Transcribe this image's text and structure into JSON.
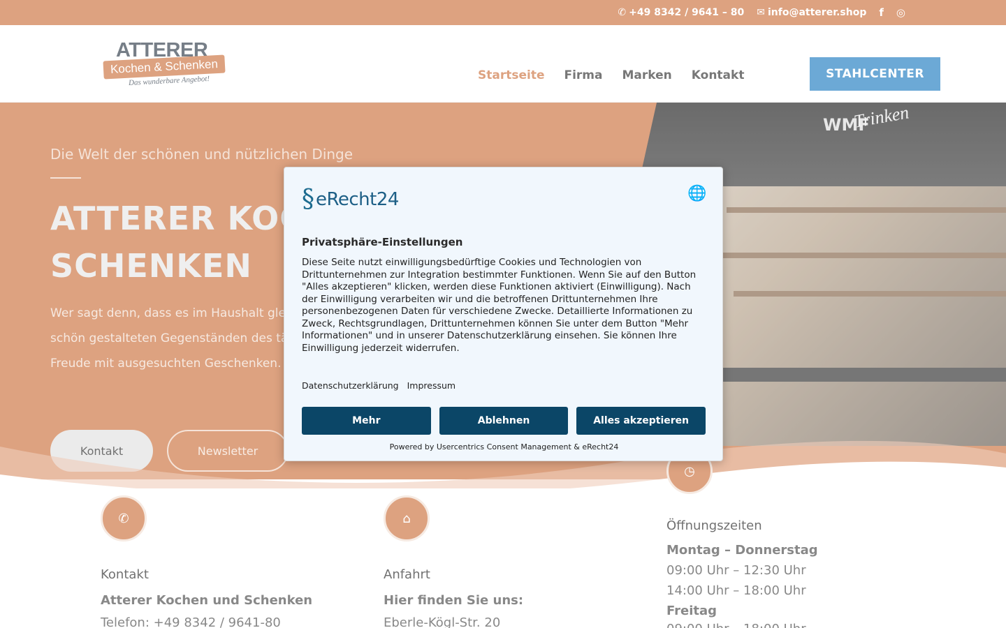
{
  "topbar": {
    "phone": "+49 8342 / 9641 – 80",
    "email": "info@atterer.shop",
    "social": [
      "facebook-icon",
      "instagram-icon"
    ]
  },
  "header": {
    "logo_line1": "ATTERER",
    "logo_line2": "Kochen & Schenken",
    "logo_line3": "Das wunderbare Angebot!",
    "nav": [
      "Startseite",
      "Firma",
      "Marken",
      "Kontakt"
    ],
    "cta": "STAHLCENTER"
  },
  "hero": {
    "tagline": "Die Welt der schönen und nützlichen Dinge",
    "title": "ATTERER KOCHEN UND SCHENKEN",
    "paragraph": "Wer sagt denn, dass es im Haushalt gleichgültig zugehen muss? Erfreuen Sie sich an schön gestalteten Gegenständen des täglichen Lebens und machen Sie anderen eine Freude mit ausgesuchten Geschenken.",
    "btn_kontakt": "Kontakt",
    "btn_newsletter": "Newsletter",
    "photo_brand": "Trinken",
    "photo_logo": "WMF"
  },
  "info": {
    "kontakt": {
      "title": "Kontakt",
      "strong": "Atterer Kochen und Schenken",
      "line": "Telefon: +49 8342 / 9641-80"
    },
    "anfahrt": {
      "title": "Anfahrt",
      "strong": "Hier finden Sie uns:",
      "line": "Eberle-Kögl-Str. 20"
    },
    "zeiten": {
      "title": "Öffnungszeiten",
      "day1": "Montag – Donnerstag",
      "t1": "09:00 Uhr – 12:30 Uhr",
      "t2": "14:00 Uhr – 18:00 Uhr",
      "day2": "Freitag",
      "t3": "09:00 Uhr – 18:00 Uhr"
    }
  },
  "consent": {
    "brand": "eRecht24",
    "heading": "Privatsphäre-Einstellungen",
    "description": "Diese Seite nutzt einwilligungsbedürftige Cookies und Technologien von Drittunternehmen zur Integration bestimmter Funktionen. Wenn Sie auf den Button \"Alles akzeptieren\" klicken, werden diese Funktionen aktiviert (Einwilligung). Nach der Einwilligung verarbeiten wir und die betroffenen Drittunternehmen Ihre personenbezogenen Daten für verschiedene Zwecke. Detaillierte Informationen zu Zweck, Rechtsgrundlagen, Drittunternehmen können Sie unter dem Button \"Mehr Informationen\" und in unserer Datenschutzerklärung einsehen. Sie können Ihre Einwilligung jederzeit widerrufen.",
    "link_privacy": "Datenschutzerklärung",
    "link_imprint": "Impressum",
    "btn_more": "Mehr",
    "btn_decline": "Ablehnen",
    "btn_accept": "Alles akzeptieren",
    "powered": "Powered by Usercentrics Consent Management & eRecht24"
  },
  "colors": {
    "brand_orange": "#cf7a4a",
    "cta_blue": "#2d84c4",
    "consent_navy": "#0b4667"
  }
}
